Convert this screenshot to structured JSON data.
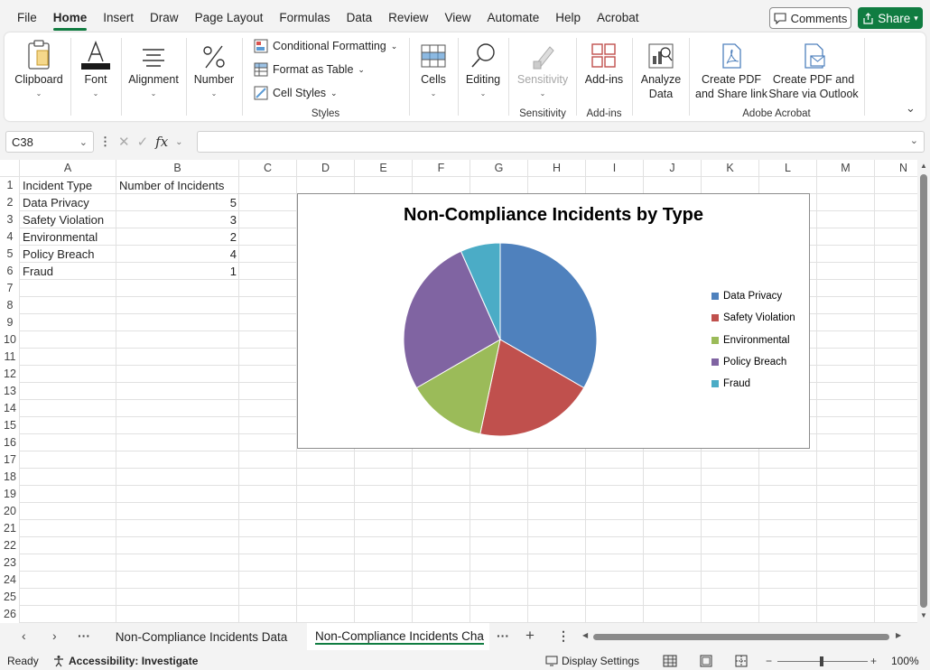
{
  "menu": {
    "tabs": [
      "File",
      "Home",
      "Insert",
      "Draw",
      "Page Layout",
      "Formulas",
      "Data",
      "Review",
      "View",
      "Automate",
      "Help",
      "Acrobat"
    ],
    "active": "Home",
    "comments_label": "Comments",
    "share_label": "Share"
  },
  "ribbon": {
    "clipboard": "Clipboard",
    "font": "Font",
    "alignment": "Alignment",
    "number": "Number",
    "conditional_formatting": "Conditional Formatting",
    "format_as_table": "Format as Table",
    "cell_styles": "Cell Styles",
    "styles_group": "Styles",
    "cells": "Cells",
    "editing": "Editing",
    "sensitivity_btn": "Sensitivity",
    "sensitivity_group": "Sensitivity",
    "addins_btn": "Add-ins",
    "addins_group": "Add-ins",
    "analyze_data_1": "Analyze",
    "analyze_data_2": "Data",
    "create_pdf_1": "Create PDF",
    "create_pdf_2": "and Share link",
    "create_pdf_outlook_1": "Create PDF and",
    "create_pdf_outlook_2": "Share via Outlook",
    "adobe_group": "Adobe Acrobat"
  },
  "formula_bar": {
    "name_box": "C38",
    "fx": "fx",
    "value": ""
  },
  "grid": {
    "columns": [
      "A",
      "B",
      "C",
      "D",
      "E",
      "F",
      "G",
      "H",
      "I",
      "J",
      "K",
      "L",
      "M",
      "N"
    ],
    "rows": [
      "1",
      "2",
      "3",
      "4",
      "5",
      "6",
      "7",
      "8",
      "9",
      "10",
      "11",
      "12",
      "13",
      "14",
      "15",
      "16",
      "17",
      "18",
      "19",
      "20",
      "21",
      "22",
      "23",
      "24",
      "25",
      "26"
    ],
    "header_a": "Incident Type",
    "header_b": "Number of Incidents",
    "data": [
      {
        "type": "Data Privacy",
        "count": "5"
      },
      {
        "type": "Safety Violation",
        "count": "3"
      },
      {
        "type": "Environmental",
        "count": "2"
      },
      {
        "type": "Policy Breach",
        "count": "4"
      },
      {
        "type": "Fraud",
        "count": "1"
      }
    ]
  },
  "chart_data": {
    "type": "pie",
    "title": "Non-Compliance Incidents by Type",
    "categories": [
      "Data Privacy",
      "Safety Violation",
      "Environmental",
      "Policy Breach",
      "Fraud"
    ],
    "values": [
      5,
      3,
      2,
      4,
      1
    ],
    "colors": [
      "#4f81bd",
      "#c0504d",
      "#9bbb59",
      "#8064a2",
      "#4bacc6"
    ],
    "legend_position": "right"
  },
  "sheets": {
    "tab1": "Non-Compliance Incidents Data",
    "tab2": "Non-Compliance Incidents Cha",
    "active": "tab2"
  },
  "status": {
    "ready": "Ready",
    "accessibility": "Accessibility: Investigate",
    "display_settings": "Display Settings",
    "zoom": "100%"
  },
  "accent_color": "#107c41"
}
